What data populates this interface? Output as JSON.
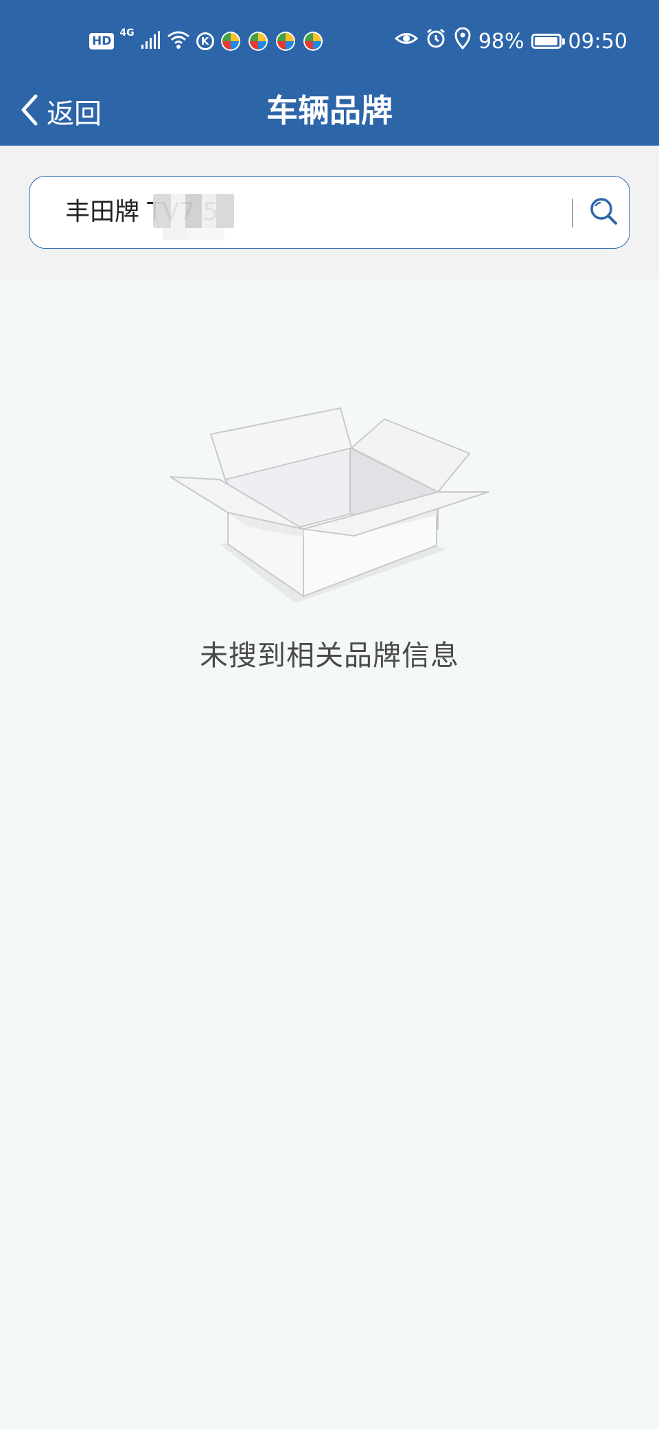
{
  "status_bar": {
    "hd": "HD",
    "network": "4G",
    "k_label": "K",
    "battery": "98%",
    "battery_level": 0.98,
    "time": "09:50"
  },
  "nav": {
    "back_label": "返回",
    "title": "车辆品牌"
  },
  "search": {
    "value": "丰田牌 TV7        5"
  },
  "empty_state": {
    "message": "未搜到相关品牌信息"
  },
  "colors": {
    "primary": "#2d65a9",
    "page_background": "#f4f8f9",
    "search_section_background": "#f2f2f2"
  }
}
